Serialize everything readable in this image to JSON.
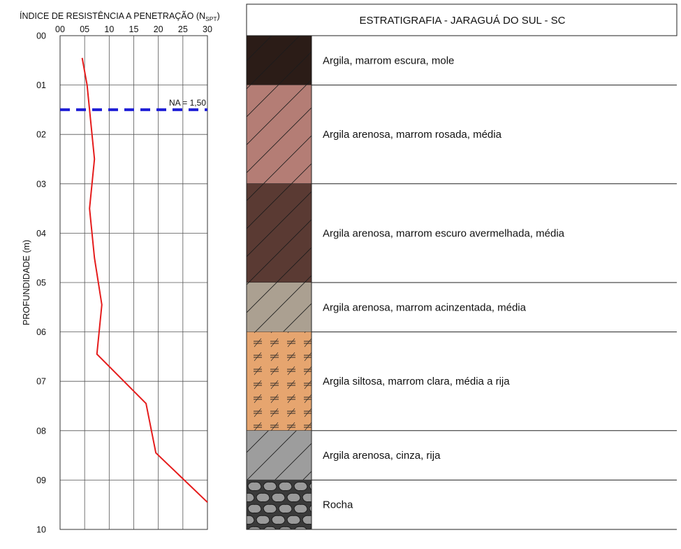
{
  "chart_data": {
    "type": "line",
    "title": "ÍNDICE DE RESISTÊNCIA A PENETRAÇÃO (N",
    "title_sub": "SPT",
    "title_close": ")",
    "xlabel": "",
    "ylabel": "PROFUNDIDADE (m)",
    "xlim": [
      0,
      30
    ],
    "ylim": [
      0,
      10
    ],
    "x_axis_position": "top",
    "y_inverted": true,
    "grid": true,
    "x_ticks": [
      0,
      5,
      10,
      15,
      20,
      25,
      30
    ],
    "x_tick_labels": [
      "00",
      "05",
      "10",
      "15",
      "20",
      "25",
      "30"
    ],
    "y_ticks": [
      0,
      1,
      2,
      3,
      4,
      5,
      6,
      7,
      8,
      9,
      10
    ],
    "y_tick_labels": [
      "00",
      "01",
      "02",
      "03",
      "04",
      "05",
      "06",
      "07",
      "08",
      "09",
      "10"
    ],
    "series": [
      {
        "color": "#e51c1c",
        "points": [
          {
            "x": 4.5,
            "y": 0.45
          },
          {
            "x": 5.5,
            "y": 1.0
          },
          {
            "x": 6.0,
            "y": 1.5
          },
          {
            "x": 6.5,
            "y": 2.0
          },
          {
            "x": 7.0,
            "y": 2.5
          },
          {
            "x": 6.0,
            "y": 3.5
          },
          {
            "x": 7.0,
            "y": 4.5
          },
          {
            "x": 8.5,
            "y": 5.45
          },
          {
            "x": 7.5,
            "y": 6.45
          },
          {
            "x": 17.5,
            "y": 7.45
          },
          {
            "x": 19.5,
            "y": 8.45
          },
          {
            "x": 30.0,
            "y": 9.45
          }
        ]
      }
    ],
    "water_level": {
      "depth": 1.5,
      "label": "NA = 1,50",
      "color": "#1f1fd6"
    }
  },
  "strat": {
    "title": "ESTRATIGRAFIA - JARAGUÁ DO SUL - SC",
    "layers": [
      {
        "top": 0,
        "bottom": 1,
        "label": "Argila, marrom escura, mole",
        "fill": "#2b1c17",
        "pattern": "hatch"
      },
      {
        "top": 1,
        "bottom": 3,
        "label": "Argila arenosa, marrom rosada, média",
        "fill": "#b47d75",
        "pattern": "hatch"
      },
      {
        "top": 3,
        "bottom": 5,
        "label": "Argila arenosa, marrom escuro avermelhada, média",
        "fill": "#5a3a33",
        "pattern": "hatch"
      },
      {
        "top": 5,
        "bottom": 6,
        "label": "Argila arenosa, marrom acinzentada, média",
        "fill": "#aba091",
        "pattern": "hatch"
      },
      {
        "top": 6,
        "bottom": 8,
        "label": "Argila siltosa, marrom clara, média a rija",
        "fill": "#e6a56f",
        "pattern": "silt"
      },
      {
        "top": 8,
        "bottom": 9,
        "label": "Argila arenosa, cinza, rija",
        "fill": "#9d9d9d",
        "pattern": "hatch"
      },
      {
        "top": 9,
        "bottom": 10,
        "label": "Rocha",
        "fill": "#8a8a8a",
        "pattern": "rock"
      }
    ]
  }
}
